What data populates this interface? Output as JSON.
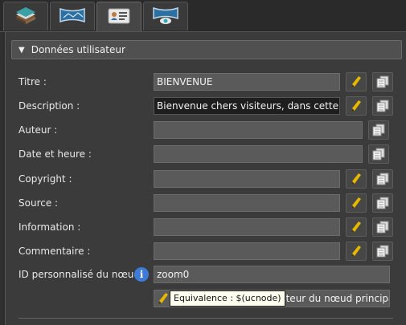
{
  "tabs": [
    {
      "icon": "book-stack-icon"
    },
    {
      "icon": "panorama-icon"
    },
    {
      "icon": "id-card-icon"
    },
    {
      "icon": "panorama-view-icon"
    }
  ],
  "section": {
    "title": "Données utilisateur"
  },
  "fields": {
    "titre": {
      "label": "Titre :",
      "value": "BIENVENUE"
    },
    "description": {
      "label": "Description :",
      "value": "Bienvenue chers visiteurs, dans cette visite g"
    },
    "auteur": {
      "label": "Auteur :",
      "value": ""
    },
    "date": {
      "label": "Date et heure :",
      "value": ""
    },
    "copyright": {
      "label": "Copyright :",
      "value": ""
    },
    "source": {
      "label": "Source :",
      "value": ""
    },
    "information": {
      "label": "Information :",
      "value": ""
    },
    "commentaire": {
      "label": "Commentaire :",
      "value": ""
    },
    "node_id": {
      "label": "ID personnalisé du nœud :",
      "value": "zoom0"
    }
  },
  "use_main_button": {
    "label": "sateur du nœud principal"
  },
  "tooltip": {
    "text": "Equivalence : $(ucnode)"
  },
  "colors": {
    "info_blue": "#3d7bd8",
    "pencil_yellow": "#e8b800"
  }
}
